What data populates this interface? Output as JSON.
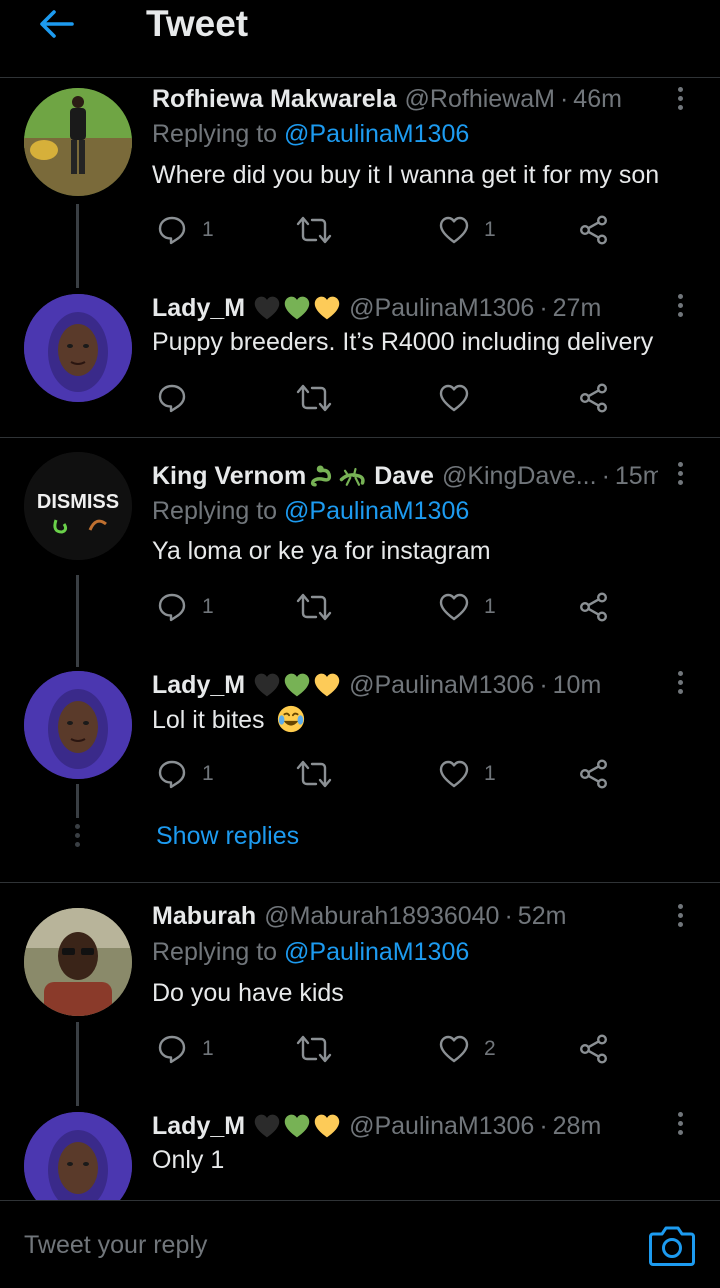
{
  "header": {
    "title": "Tweet"
  },
  "tweets": [
    {
      "name": "Rofhiewa Makwarela",
      "handle": "@RofhiewaM",
      "time": "46m",
      "replying_label": "Replying to",
      "replying_to": "@PaulinaM1306",
      "text": "Where did you buy it I wanna get it for my son",
      "replies": "1",
      "retweets": "",
      "likes": "1"
    },
    {
      "name": "Lady_M",
      "handle": "@PaulinaM1306",
      "time": "27m",
      "text": "Puppy breeders. It’s R4000 including delivery",
      "replies": "",
      "retweets": "",
      "likes": ""
    },
    {
      "name": "King Vernom",
      "name_suffix": "Dave",
      "handle": "@KingDave...",
      "time": "15m",
      "avatar_text": "DISMISS",
      "replying_label": "Replying to",
      "replying_to": "@PaulinaM1306",
      "text": "Ya loma or ke ya for instagram",
      "replies": "1",
      "retweets": "",
      "likes": "1"
    },
    {
      "name": "Lady_M",
      "handle": "@PaulinaM1306",
      "time": "10m",
      "text": "Lol it bites",
      "replies": "1",
      "retweets": "",
      "likes": "1"
    },
    {
      "name": "Maburah",
      "handle": "@Maburah18936040",
      "time": "52m",
      "replying_label": "Replying to",
      "replying_to": "@PaulinaM1306",
      "text": "Do you have kids",
      "replies": "1",
      "retweets": "",
      "likes": "2"
    },
    {
      "name": "Lady_M",
      "handle": "@PaulinaM1306",
      "time": "28m",
      "text": "Only 1"
    }
  ],
  "show_replies": "Show replies",
  "reply_bar": {
    "placeholder": "Tweet your reply"
  },
  "colors": {
    "accent": "#1d9bf0",
    "background": "#000000",
    "secondary_text": "#71767b",
    "divider": "#2f3336"
  },
  "icons": [
    "back-arrow-icon",
    "reply-icon",
    "retweet-icon",
    "heart-icon",
    "share-icon",
    "more-icon",
    "camera-icon",
    "black-heart-emoji",
    "green-heart-emoji",
    "yellow-heart-emoji",
    "snake-emoji",
    "lizard-emoji",
    "laughing-emoji"
  ]
}
